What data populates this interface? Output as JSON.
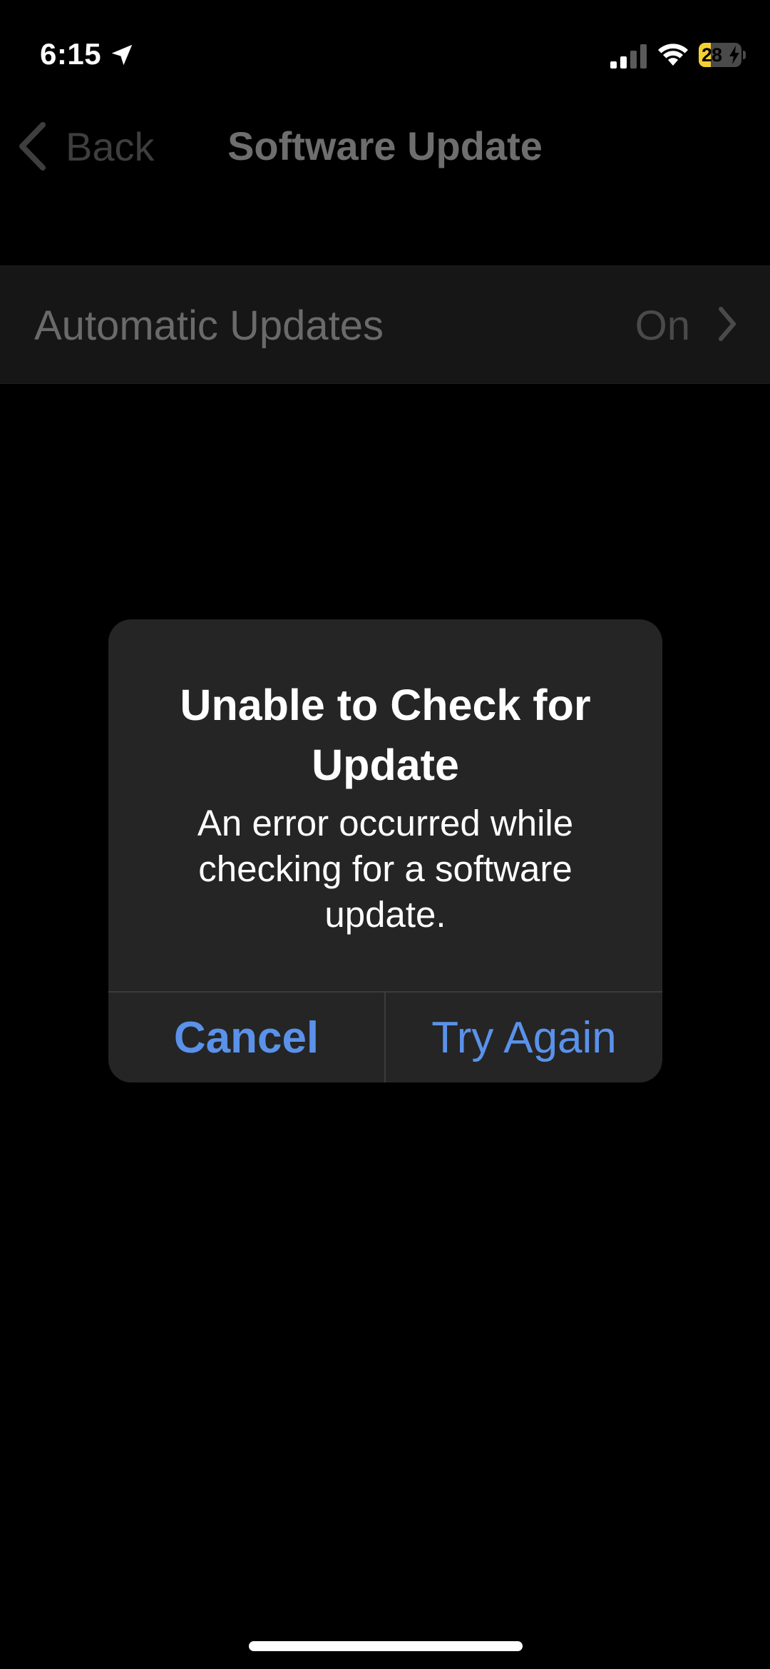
{
  "status_bar": {
    "time": "6:15",
    "location_icon": "location-arrow-icon",
    "signal_icon": "cellular-signal-icon",
    "wifi_icon": "wifi-icon",
    "battery_level": "28",
    "battery_fraction": 0.28,
    "battery_charging": true,
    "battery_color": "#f5d033"
  },
  "nav": {
    "back_label": "Back",
    "back_icon": "chevron-left-icon",
    "title": "Software Update"
  },
  "settings": {
    "rows": [
      {
        "label": "Automatic Updates",
        "value": "On",
        "icon": "chevron-right-icon"
      }
    ]
  },
  "alert": {
    "title": "Unable to Check for Update",
    "message": "An error occurred while checking for a software update.",
    "buttons": {
      "cancel_label": "Cancel",
      "try_again_label": "Try Again"
    },
    "accent_color": "#5a92ea"
  }
}
